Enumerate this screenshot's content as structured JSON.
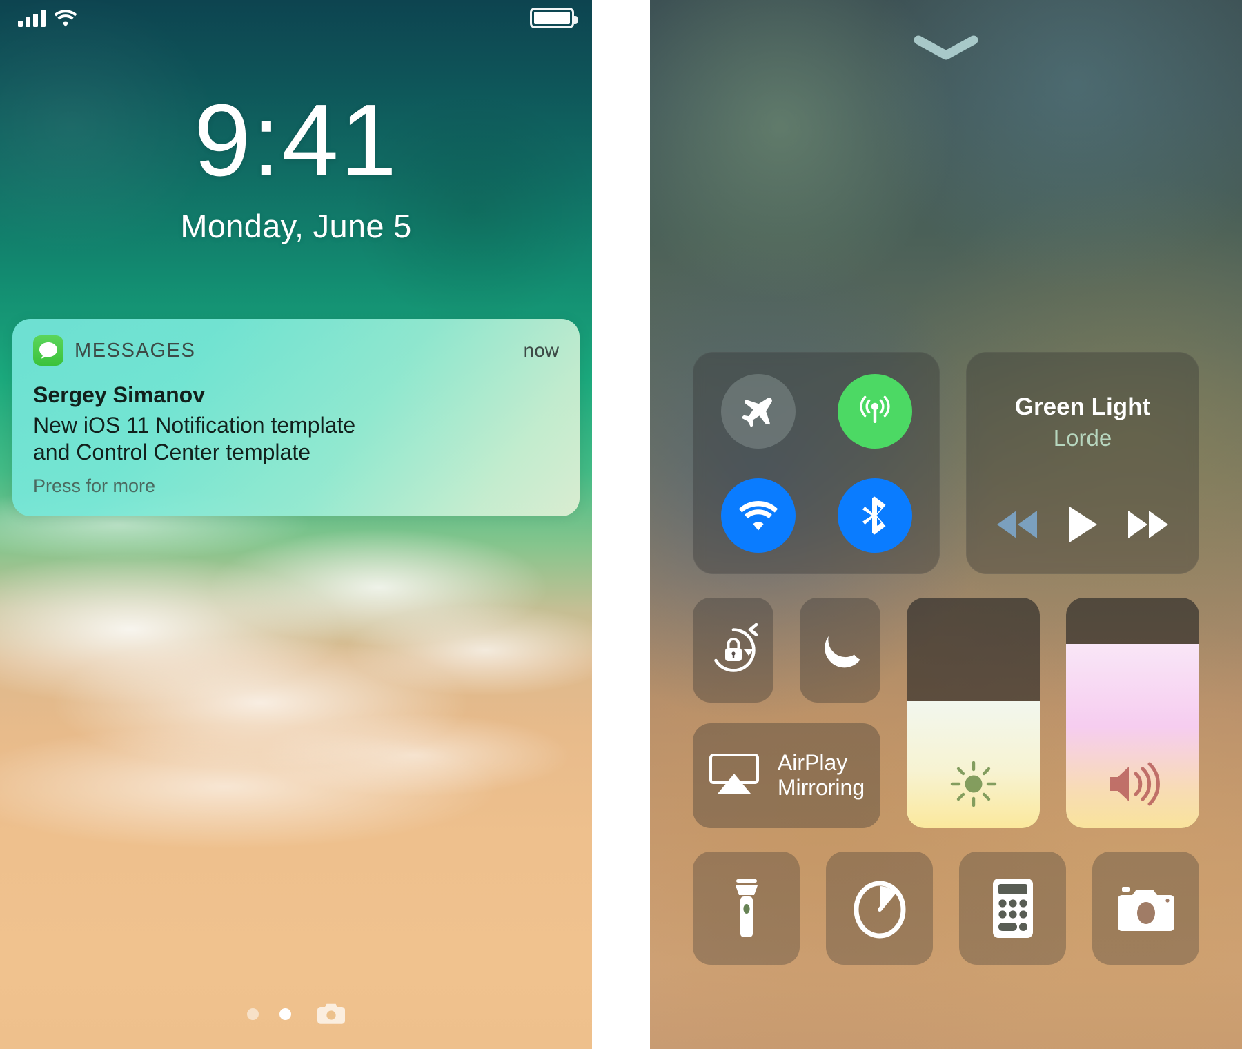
{
  "lockscreen": {
    "status_bar": {
      "signal_icon": "cellular-bars-icon",
      "signal_bars": 4,
      "wifi_icon": "wifi-icon",
      "battery_icon": "battery-full-icon",
      "battery_level": 100
    },
    "time": "9:41",
    "date": "Monday, June 5",
    "notification": {
      "app_icon": "messages-icon",
      "app_name": "MESSAGES",
      "timestamp": "now",
      "sender": "Sergey Simanov",
      "message_line1": "New iOS 11 Notification template",
      "message_line2": "and Control Center template",
      "hint": "Press for more"
    },
    "page_dots": [
      {
        "name": "page-dot-1",
        "active": false
      },
      {
        "name": "page-dot-2",
        "active": true
      }
    ],
    "camera_shortcut_icon": "camera-icon"
  },
  "control_center": {
    "grabber_icon": "chevron-down-icon",
    "connectivity": {
      "airplane": {
        "label": "Airplane Mode",
        "icon": "airplane-icon",
        "state": "off"
      },
      "cellular": {
        "label": "Cellular Data",
        "icon": "cellular-data-icon",
        "state": "on"
      },
      "wifi": {
        "label": "Wi-Fi",
        "icon": "wifi-icon",
        "state": "on"
      },
      "bluetooth": {
        "label": "Bluetooth",
        "icon": "bluetooth-icon",
        "state": "on"
      }
    },
    "now_playing": {
      "track_title": "Green Light",
      "artist": "Lorde",
      "rewind_icon": "rewind-icon",
      "play_icon": "play-icon",
      "forward_icon": "fast-forward-icon"
    },
    "toggles": {
      "rotation_lock": {
        "label": "Portrait Orientation Lock",
        "icon": "rotation-lock-icon"
      },
      "do_not_disturb": {
        "label": "Do Not Disturb",
        "icon": "moon-icon"
      }
    },
    "airplay": {
      "label_line1": "AirPlay",
      "label_line2": "Mirroring",
      "icon": "airplay-icon"
    },
    "sliders": {
      "brightness": {
        "label": "Brightness",
        "icon": "sun-icon",
        "value": 55
      },
      "volume": {
        "label": "Volume",
        "icon": "speaker-icon",
        "value": 80
      }
    },
    "shortcuts": [
      {
        "label": "Flashlight",
        "icon": "flashlight-icon"
      },
      {
        "label": "Timer",
        "icon": "timer-icon"
      },
      {
        "label": "Calculator",
        "icon": "calculator-icon"
      },
      {
        "label": "Camera",
        "icon": "camera-icon"
      }
    ]
  },
  "colors": {
    "cellular_on": "#4cd964",
    "wifi_on": "#0a7cff",
    "bluetooth_on": "#0a7cff",
    "toggle_off": "#9baaa5",
    "messages_icon": "#4cd964"
  }
}
